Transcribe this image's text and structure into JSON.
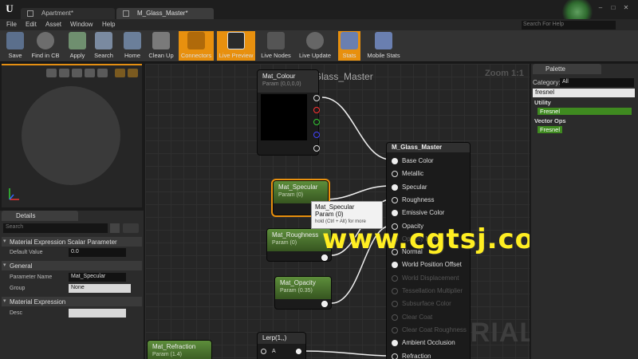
{
  "tabs": [
    {
      "label": "Apartment*"
    },
    {
      "label": "M_Glass_Master*"
    }
  ],
  "help_search": {
    "placeholder": "Search For Help"
  },
  "menu": [
    "File",
    "Edit",
    "Asset",
    "Window",
    "Help"
  ],
  "toolbar": [
    {
      "label": "Save",
      "icon": "save-icon"
    },
    {
      "label": "Find in CB",
      "icon": "find-in-cb-icon"
    },
    {
      "label": "Apply",
      "icon": "apply-icon"
    },
    {
      "label": "Search",
      "icon": "search-icon"
    },
    {
      "label": "Home",
      "icon": "home-icon"
    },
    {
      "label": "Clean Up",
      "icon": "clean-up-icon"
    },
    {
      "label": "Connectors",
      "icon": "connectors-icon",
      "active": true
    },
    {
      "label": "Live Preview",
      "icon": "live-preview-icon",
      "active": true
    },
    {
      "label": "Live Nodes",
      "icon": "live-nodes-icon"
    },
    {
      "label": "Live Update",
      "icon": "live-update-icon"
    },
    {
      "label": "Stats",
      "icon": "stats-icon",
      "active": true
    },
    {
      "label": "Mobile Stats",
      "icon": "mobile-stats-icon"
    }
  ],
  "details": {
    "tab_label": "Details",
    "search_placeholder": "Search",
    "sections": {
      "scalar": "Material Expression Scalar Parameter",
      "general": "General",
      "expression": "Material Expression"
    },
    "default_value_label": "Default Value",
    "default_value": "0.0",
    "param_name_label": "Parameter Name",
    "param_name": "Mat_Specular",
    "group_label": "Group",
    "group": "None",
    "desc_label": "Desc",
    "desc": ""
  },
  "graph": {
    "title": "M_Glass_Master",
    "zoom": "Zoom 1:1",
    "watermark_material": "MATERIAL",
    "watermark_site": "www.cgtsj.com",
    "nodes": {
      "colour": {
        "title": "Mat_Colour",
        "sub": "Param (0,0,0,0)"
      },
      "specular": {
        "title": "Mat_Specular",
        "sub": "Param (0)"
      },
      "roughness": {
        "title": "Mat_Roughness",
        "sub": "Param (0)"
      },
      "opacity": {
        "title": "Mat_Opacity",
        "sub": "Param (0.35)"
      },
      "refraction": {
        "title": "Mat_Refraction",
        "sub": "Param (1.4)"
      },
      "lerp": {
        "title": "Lerp(1,,)",
        "pin": "A"
      },
      "master": {
        "title": "M_Glass_Master",
        "inputs": [
          {
            "label": "Base Color",
            "enabled": true
          },
          {
            "label": "Metallic",
            "enabled": true
          },
          {
            "label": "Specular",
            "enabled": true
          },
          {
            "label": "Roughness",
            "enabled": true
          },
          {
            "label": "Emissive Color",
            "enabled": true
          },
          {
            "label": "Opacity",
            "enabled": true
          },
          {
            "label": "Opacity Mask",
            "enabled": false
          },
          {
            "label": "Normal",
            "enabled": true
          },
          {
            "label": "World Position Offset",
            "enabled": true
          },
          {
            "label": "World Displacement",
            "enabled": false
          },
          {
            "label": "Tessellation Multiplier",
            "enabled": false
          },
          {
            "label": "Subsurface Color",
            "enabled": false
          },
          {
            "label": "Clear Coat",
            "enabled": false
          },
          {
            "label": "Clear Coat Roughness",
            "enabled": false
          },
          {
            "label": "Ambient Occlusion",
            "enabled": true
          },
          {
            "label": "Refraction",
            "enabled": true
          }
        ]
      }
    },
    "tooltip": {
      "line1": "Mat_Specular",
      "line2": "Param (0)",
      "hint": "hold (Ctrl + Alt) for more"
    }
  },
  "palette": {
    "tab_label": "Palette",
    "category_label": "Category:",
    "category": "All",
    "search": "fresnel",
    "groups": [
      {
        "name": "Utility",
        "items": [
          "Fresnel"
        ]
      },
      {
        "name": "Vector Ops",
        "items": [
          "Fresnel"
        ]
      }
    ]
  },
  "colors": {
    "accent": "#e8900e",
    "node_header": "#4f7d32",
    "palette_item": "#3f8a20",
    "watermark": "#ffee22"
  }
}
